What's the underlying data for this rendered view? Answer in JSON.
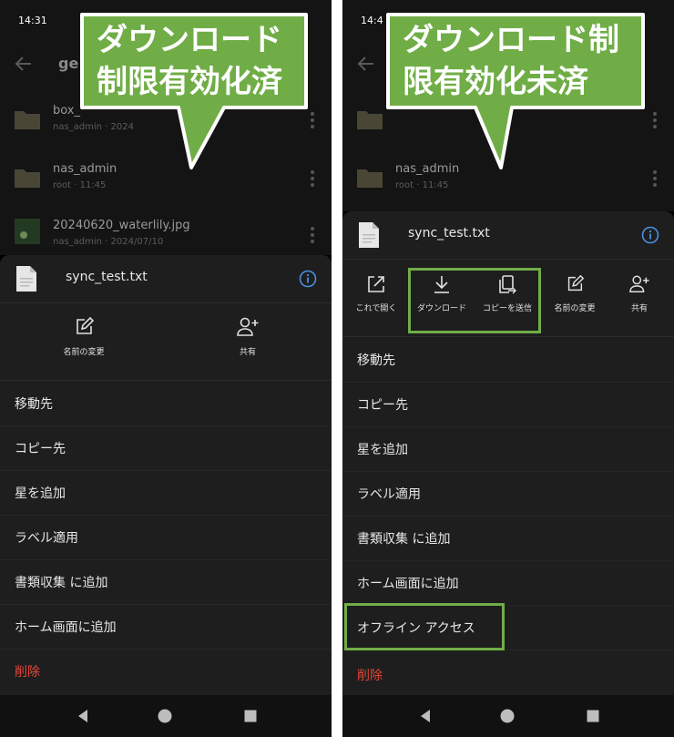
{
  "left": {
    "status_time": "14:31",
    "appbar_title": "ge",
    "files": [
      {
        "name": "box_",
        "meta": "nas_admin · 2024"
      },
      {
        "name": "nas_admin",
        "meta": "root · 11:45"
      },
      {
        "name": "20240620_waterlily.jpg",
        "meta": "nas_admin · 2024/07/10"
      }
    ],
    "sheet": {
      "file_name": "sync_test.txt",
      "actions": [
        {
          "label": "名前の変更",
          "icon": "rename-icon"
        },
        {
          "label": "共有",
          "icon": "share-person-icon"
        }
      ],
      "menu": [
        "移動先",
        "コピー先",
        "星を追加",
        "ラベル適用",
        "書類収集 に追加",
        "ホーム画面に追加"
      ],
      "delete_label": "削除"
    },
    "callout_lines": [
      "ダウンロード",
      "制限有効化済"
    ]
  },
  "right": {
    "status_time": "14:4",
    "files": [
      {
        "name": "",
        "meta": ""
      },
      {
        "name": "nas_admin",
        "meta": "root · 11:45"
      }
    ],
    "sheet": {
      "file_name": "sync_test.txt",
      "actions": [
        {
          "label": "これで開く",
          "icon": "open-external-icon"
        },
        {
          "label": "ダウンロード",
          "icon": "download-icon"
        },
        {
          "label": "コピーを送信",
          "icon": "copy-send-icon"
        },
        {
          "label": "名前の変更",
          "icon": "rename-icon"
        },
        {
          "label": "共有",
          "icon": "share-person-icon"
        }
      ],
      "menu": [
        "移動先",
        "コピー先",
        "星を追加",
        "ラベル適用",
        "書類収集 に追加",
        "ホーム画面に追加",
        "オフライン アクセス"
      ],
      "delete_label": "削除"
    },
    "callout_lines": [
      "ダウンロード制",
      "限有効化未済"
    ]
  },
  "colors": {
    "callout_fill": "#70ad47",
    "highlight": "#70ad47",
    "info_blue": "#4a90e2",
    "delete_red": "#e5473b",
    "sheet_bg": "#1e1e1e"
  }
}
